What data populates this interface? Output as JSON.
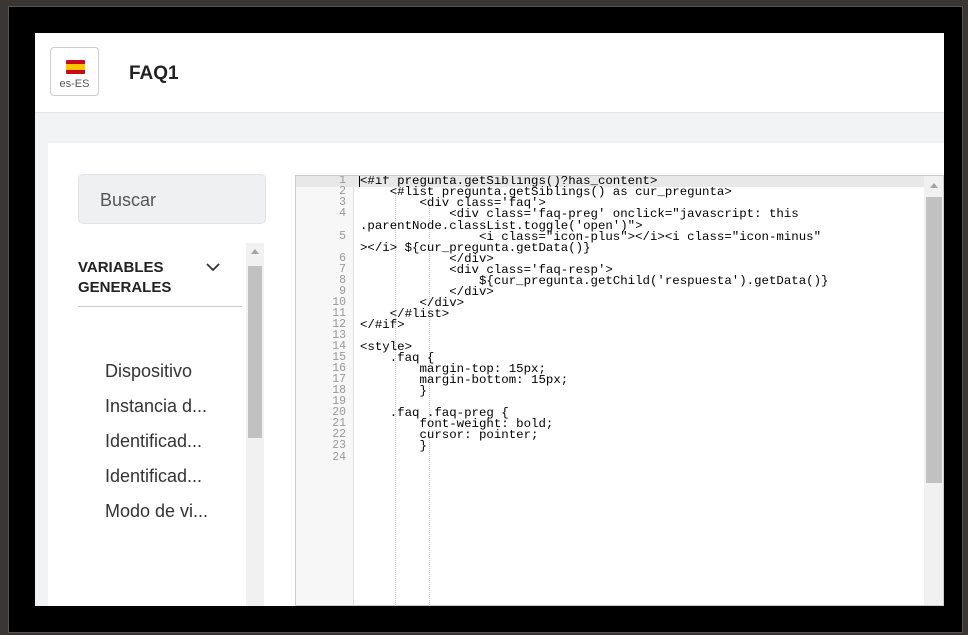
{
  "header": {
    "lang_code": "es-ES",
    "title": "FAQ1",
    "flag_colors": [
      "#c60b1e",
      "#ffc400",
      "#c60b1e"
    ]
  },
  "search": {
    "placeholder": "Buscar"
  },
  "variables": {
    "section_title": "VARIABLES GENERALES",
    "items": [
      "Dispositivo",
      "Instancia d...",
      "Identificad...",
      "Identificad...",
      "Modo de vi..."
    ]
  },
  "editor": {
    "lines": [
      {
        "n": "1",
        "text": "<#if pregunta.getSiblings()?has_content>"
      },
      {
        "n": "2",
        "text": "    <#list pregunta.getSiblings() as cur_pregunta>"
      },
      {
        "n": "3",
        "text": "        <div class='faq'>"
      },
      {
        "n": "4",
        "text": "            <div class='faq-preg' onclick=\"javascript: this"
      },
      {
        "n": "",
        "text": ".parentNode.classList.toggle('open')\">"
      },
      {
        "n": "5",
        "text": "                <i class=\"icon-plus\"></i><i class=\"icon-minus\""
      },
      {
        "n": "",
        "text": "></i> ${cur_pregunta.getData()}"
      },
      {
        "n": "6",
        "text": "            </div>"
      },
      {
        "n": "7",
        "text": "            <div class='faq-resp'>"
      },
      {
        "n": "8",
        "text": "                ${cur_pregunta.getChild('respuesta').getData()}"
      },
      {
        "n": "9",
        "text": "            </div>"
      },
      {
        "n": "10",
        "text": "        </div>"
      },
      {
        "n": "11",
        "text": "    </#list>"
      },
      {
        "n": "12",
        "text": "</#if>"
      },
      {
        "n": "13",
        "text": ""
      },
      {
        "n": "14",
        "text": "<style>"
      },
      {
        "n": "15",
        "text": "    .faq {"
      },
      {
        "n": "16",
        "text": "        margin-top: 15px;"
      },
      {
        "n": "17",
        "text": "        margin-bottom: 15px;"
      },
      {
        "n": "18",
        "text": "        }"
      },
      {
        "n": "19",
        "text": ""
      },
      {
        "n": "20",
        "text": "    .faq .faq-preg {"
      },
      {
        "n": "21",
        "text": "        font-weight: bold;"
      },
      {
        "n": "22",
        "text": "        cursor: pointer;"
      },
      {
        "n": "23",
        "text": "        }"
      },
      {
        "n": "24",
        "text": ""
      }
    ]
  },
  "colors": {
    "app_bg": "#f1f3f5",
    "keyword": "#0000cc",
    "active_line": "#e8e8e8"
  }
}
